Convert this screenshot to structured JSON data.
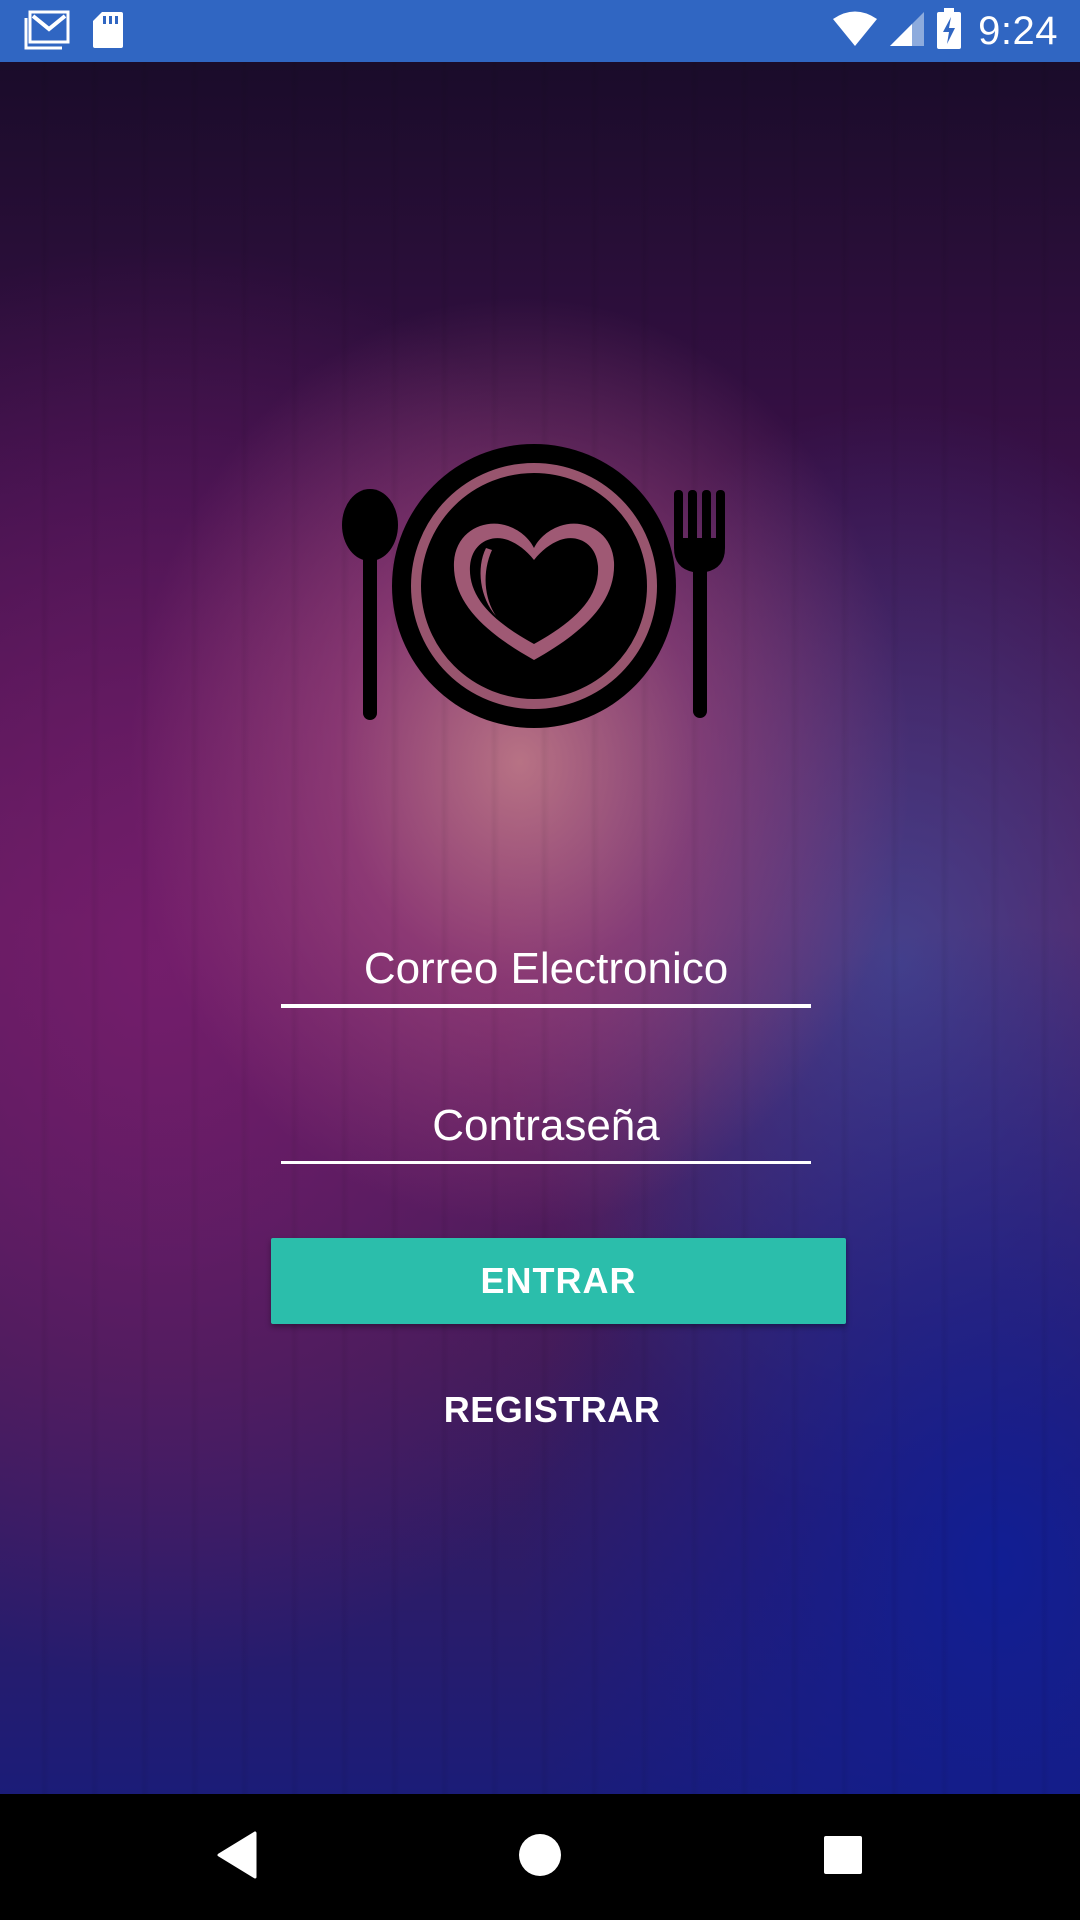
{
  "status_bar": {
    "time": "9:24",
    "icons": [
      "gmail-icon",
      "sd-card-icon",
      "wifi-icon",
      "cell-signal-icon",
      "battery-charging-icon"
    ],
    "background_color": "#3066c2"
  },
  "logo": {
    "icon": "plate-heart-cutlery-icon"
  },
  "login_form": {
    "email_placeholder": "Correo Electronico",
    "password_placeholder": "Contraseña",
    "enter_label": "ENTRAR",
    "register_label": "REGISTRAR"
  },
  "colors": {
    "accent": "#2bbeab",
    "text": "#ffffff",
    "nav_background": "#000000"
  },
  "nav_bar": {
    "icons": [
      "back-icon",
      "home-icon",
      "recents-icon"
    ]
  }
}
